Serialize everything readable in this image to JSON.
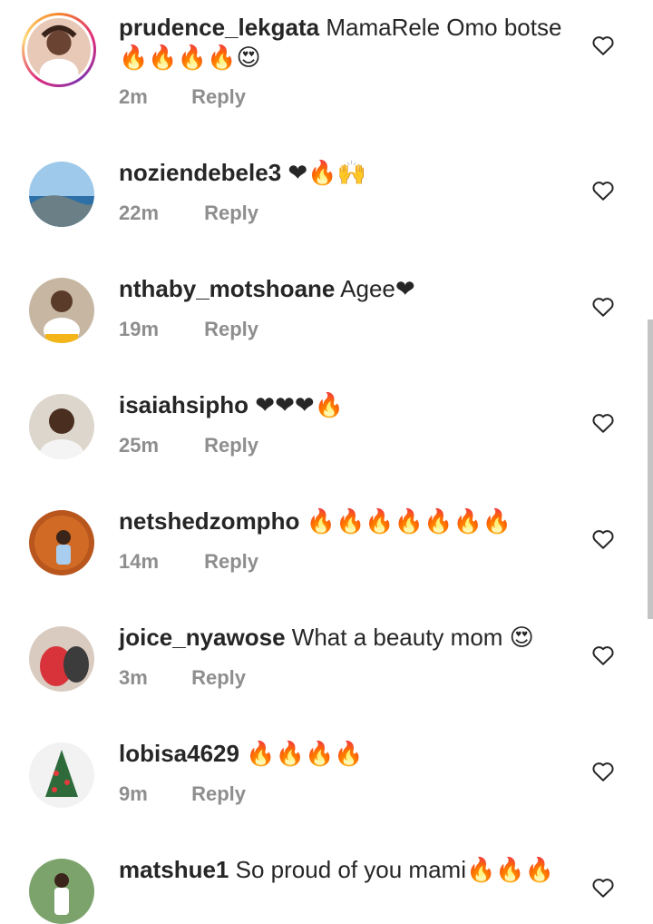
{
  "comments": [
    {
      "username": "prudence_lekgata",
      "text": "MamaRele Omo botse",
      "emojis": "🔥🔥🔥🔥😍",
      "time": "2m",
      "reply": "Reply"
    },
    {
      "username": "noziendebele3",
      "text": "",
      "emojis": "❤🔥🙌",
      "time": "22m",
      "reply": "Reply"
    },
    {
      "username": "nthaby_motshoane",
      "text": "Agee",
      "emojis": "❤",
      "time": "19m",
      "reply": "Reply"
    },
    {
      "username": "isaiahsipho",
      "text": "",
      "emojis": "❤❤❤🔥",
      "time": "25m",
      "reply": "Reply"
    },
    {
      "username": "netshedzompho",
      "text": "",
      "emojis": "🔥🔥🔥🔥🔥🔥🔥",
      "time": "14m",
      "reply": "Reply"
    },
    {
      "username": "joice_nyawose",
      "text": "What a beauty mom",
      "emojis": "😍",
      "time": "3m",
      "reply": "Reply"
    },
    {
      "username": "lobisa4629",
      "text": "",
      "emojis": "🔥🔥🔥🔥",
      "time": "9m",
      "reply": "Reply"
    },
    {
      "username": "matshue1",
      "text": "So proud of you mami",
      "emojis": "🔥🔥🔥",
      "time": "",
      "reply": ""
    }
  ],
  "icons": {
    "like": "heart-outline-icon"
  },
  "colors": {
    "secondary_text": "#8e8e8e",
    "primary_text": "#262626"
  }
}
